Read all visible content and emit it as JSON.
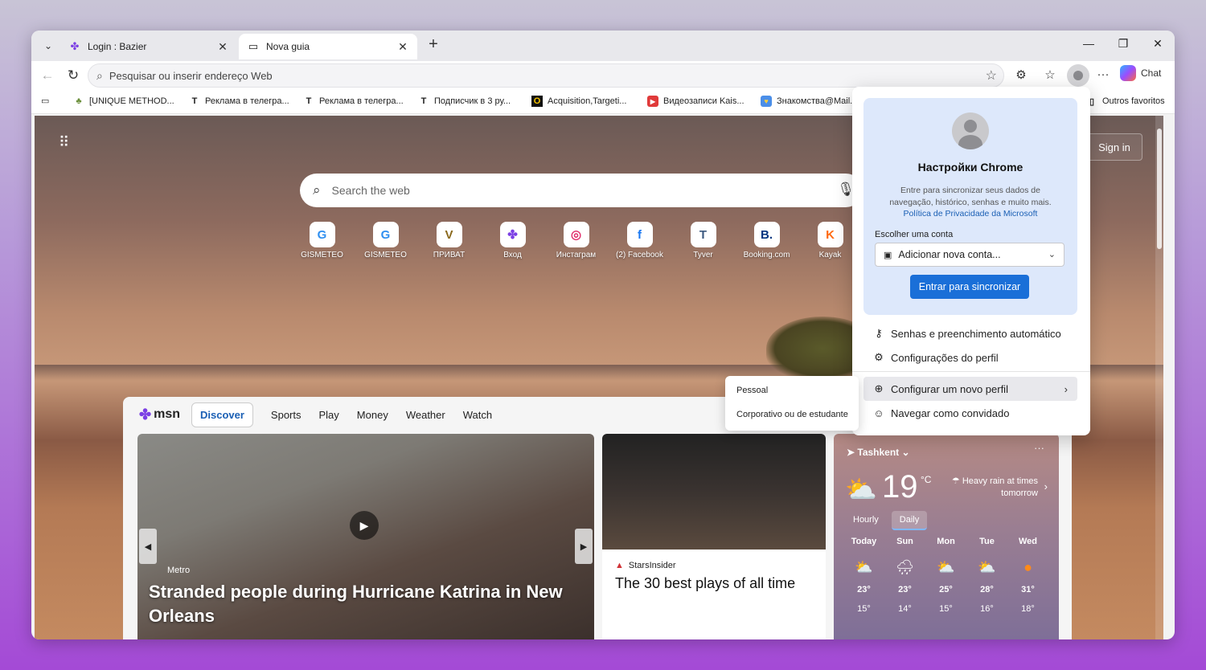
{
  "tabs": [
    {
      "label": "Login : Bazier",
      "icon": "bazier-icon"
    },
    {
      "label": "Nova guia",
      "icon": "newtab-page-icon"
    }
  ],
  "address_bar": {
    "placeholder": "Pesquisar ou inserir endereço Web"
  },
  "toolbar": {
    "chat_label": "Chat",
    "more_label": "···"
  },
  "bookmarks": [
    {
      "label": "[UNIQUE METHOD...",
      "icon": "money-bag-icon"
    },
    {
      "label": "Реклама в телегра...",
      "icon": "T"
    },
    {
      "label": "Реклама в телегра...",
      "icon": "T"
    },
    {
      "label": "Подписчик в 3 ру...",
      "icon": "T"
    },
    {
      "label": "Acquisition,Targeti...",
      "icon": "O"
    },
    {
      "label": "Видеозаписи Kais...",
      "icon": "video-icon"
    },
    {
      "label": "Знакомства@Mail...",
      "icon": "heart-icon"
    }
  ],
  "other_favorites": "Outros favoritos",
  "page": {
    "sign_in": "Sign in",
    "search_placeholder": "Search the web",
    "quick_links": [
      {
        "label": "GISMETEO",
        "letter": "G",
        "color": "#2f8ff0"
      },
      {
        "label": "GISMETEO",
        "letter": "G",
        "color": "#2f8ff0"
      },
      {
        "label": "ПРИВАТ",
        "letter": "V",
        "color": "#8b6a1e"
      },
      {
        "label": "Вход",
        "letter": "✤",
        "color": "#7b3fe4"
      },
      {
        "label": "Инстаграм",
        "letter": "◎",
        "color": "#e1306c"
      },
      {
        "label": "(2) Facebook",
        "letter": "f",
        "color": "#1877f2"
      },
      {
        "label": "Tyver",
        "letter": "T",
        "color": "#3d5a80"
      },
      {
        "label": "Booking.com",
        "letter": "B.",
        "color": "#003580"
      },
      {
        "label": "Kayak",
        "letter": "K",
        "color": "#ff690f"
      }
    ]
  },
  "msn": {
    "logo": "msn",
    "nav": [
      "Discover",
      "Sports",
      "Play",
      "Money",
      "Weather",
      "Watch"
    ],
    "hero": {
      "source": "Metro",
      "title": "Stranded people during Hurricane Katrina in New Orleans"
    },
    "card2": {
      "source": "StarsInsider",
      "title": "The 30 best plays of all time"
    }
  },
  "weather": {
    "location": "Tashkent",
    "temp": "19",
    "unit": "°C",
    "alert": "Heavy rain at times tomorrow",
    "tabs": [
      "Hourly",
      "Daily"
    ],
    "days": [
      {
        "name": "Today",
        "icon": "⛅",
        "hi": "23°",
        "lo": "15°"
      },
      {
        "name": "Sun",
        "icon": "🌧",
        "hi": "23°",
        "lo": "14°"
      },
      {
        "name": "Mon",
        "icon": "⛅",
        "hi": "25°",
        "lo": "15°"
      },
      {
        "name": "Tue",
        "icon": "⛅",
        "hi": "28°",
        "lo": "16°"
      },
      {
        "name": "Wed",
        "icon": "●",
        "hi": "31°",
        "lo": "18°"
      }
    ]
  },
  "profile_panel": {
    "title": "Настройки Chrome",
    "description": "Entre para sincronizar seus dados de navegação, histórico, senhas e muito mais.",
    "privacy_link": "Política de Privacidade da Microsoft",
    "choose_label": "Escolher uma conta",
    "select_value": "Adicionar nova conta...",
    "sync_button": "Entrar para sincronizar",
    "items": [
      {
        "label": "Senhas e preenchimento automático",
        "icon": "key-icon"
      },
      {
        "label": "Configurações do perfil",
        "icon": "profile-settings-icon"
      },
      {
        "label": "Configurar um novo perfil",
        "icon": "new-profile-icon"
      },
      {
        "label": "Navegar como convidado",
        "icon": "guest-icon"
      }
    ]
  },
  "submenu": [
    "Pessoal",
    "Corporativo ou de estudante"
  ]
}
